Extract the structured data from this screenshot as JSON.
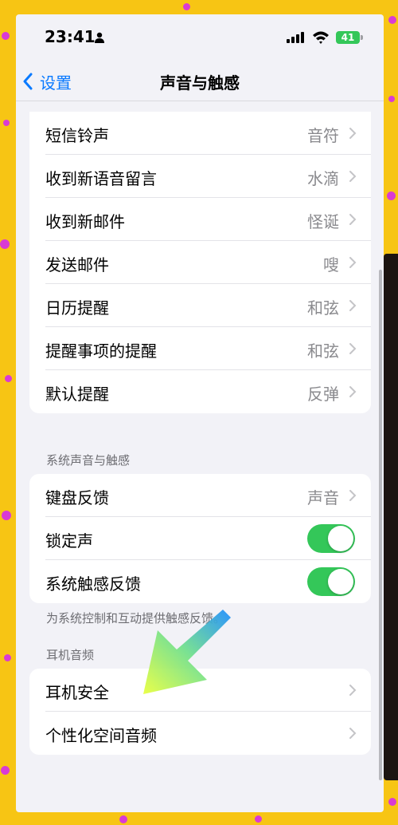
{
  "status_bar": {
    "time": "23:41",
    "battery": "41"
  },
  "nav": {
    "back_label": "设置",
    "title": "声音与触感"
  },
  "ringtones": [
    {
      "label": "短信铃声",
      "value": "音符"
    },
    {
      "label": "收到新语音留言",
      "value": "水滴"
    },
    {
      "label": "收到新邮件",
      "value": "怪诞"
    },
    {
      "label": "发送邮件",
      "value": "嗖"
    },
    {
      "label": "日历提醒",
      "value": "和弦"
    },
    {
      "label": "提醒事项的提醒",
      "value": "和弦"
    },
    {
      "label": "默认提醒",
      "value": "反弹"
    }
  ],
  "system": {
    "header": "系统声音与触感",
    "keyboard_label": "键盘反馈",
    "keyboard_value": "声音",
    "lock_label": "锁定声",
    "lock_on": true,
    "haptics_label": "系统触感反馈",
    "haptics_on": true,
    "footer": "为系统控制和互动提供触感反馈。"
  },
  "headphone": {
    "header": "耳机音频",
    "items": [
      {
        "label": "耳机安全"
      },
      {
        "label": "个性化空间音频"
      }
    ]
  },
  "colors": {
    "accent": "#0a7aff",
    "toggle_on": "#34c759",
    "frame": "#f7c514",
    "dots": "#d93bd4"
  }
}
